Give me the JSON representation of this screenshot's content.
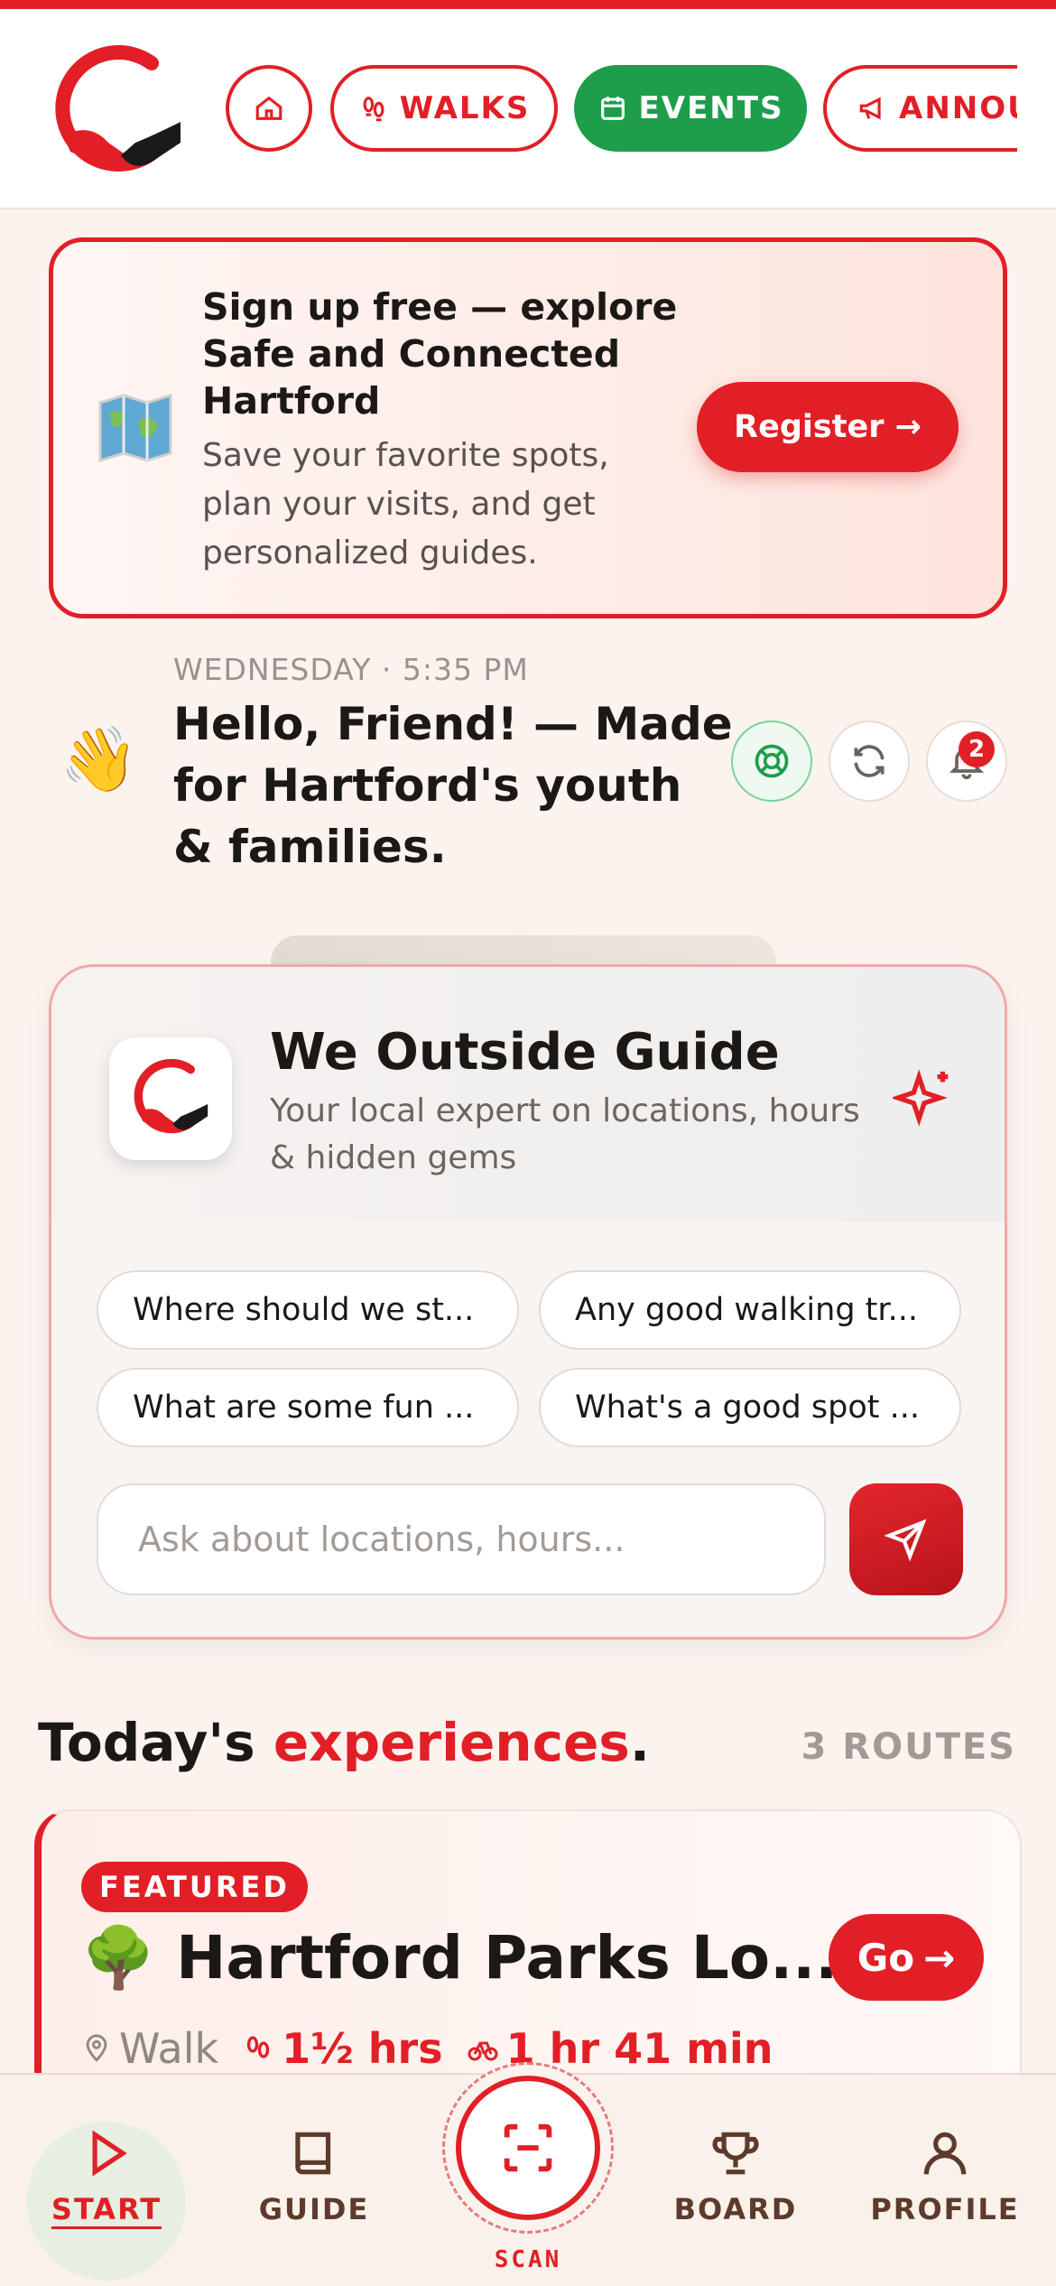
{
  "header": {
    "nav": [
      {
        "label": "",
        "icon": "home-icon"
      },
      {
        "label": "WALKS",
        "icon": "footprints-icon"
      },
      {
        "label": "EVENTS",
        "icon": "calendar-icon"
      },
      {
        "label": "ANNOU",
        "icon": "megaphone-icon"
      }
    ]
  },
  "register": {
    "title": "Sign up free — explore Safe and Connected Hartford",
    "subtitle": "Save your favorite spots, plan your visits, and get personalized guides.",
    "button": "Register",
    "icon": "map-icon"
  },
  "greeting": {
    "day": "WEDNESDAY · 5:35 PM",
    "text": "Hello, Friend! — Made for Hartford's youth & families.",
    "emoji": "👋",
    "notification_count": "2"
  },
  "guide": {
    "title": "We Outside Guide",
    "subtitle": "Your local expert on locations, hours & hidden gems",
    "suggestions": [
      "Where should we st...",
      "Any good walking tr...",
      "What are some fun ...",
      "What's a good spot ..."
    ],
    "input_placeholder": "Ask about locations, hours..."
  },
  "experiences": {
    "title_prefix": "Today's ",
    "title_accent": "experiences",
    "title_suffix": ".",
    "count": "3 ROUTES",
    "featured": {
      "badge": "FEATURED",
      "emoji": "🌳",
      "title": "Hartford Parks Lo...",
      "go": "Go",
      "type": "Walk",
      "walk_time": "1½ hrs",
      "bike_time": "1 hr 41 min"
    }
  },
  "bottom_nav": {
    "start": "START",
    "guide": "GUIDE",
    "scan": "SCAN",
    "board": "BOARD",
    "profile": "PROFILE"
  },
  "colors": {
    "accent": "#e21f26",
    "green": "#1e9e4a",
    "background": "#fbf3ee"
  }
}
